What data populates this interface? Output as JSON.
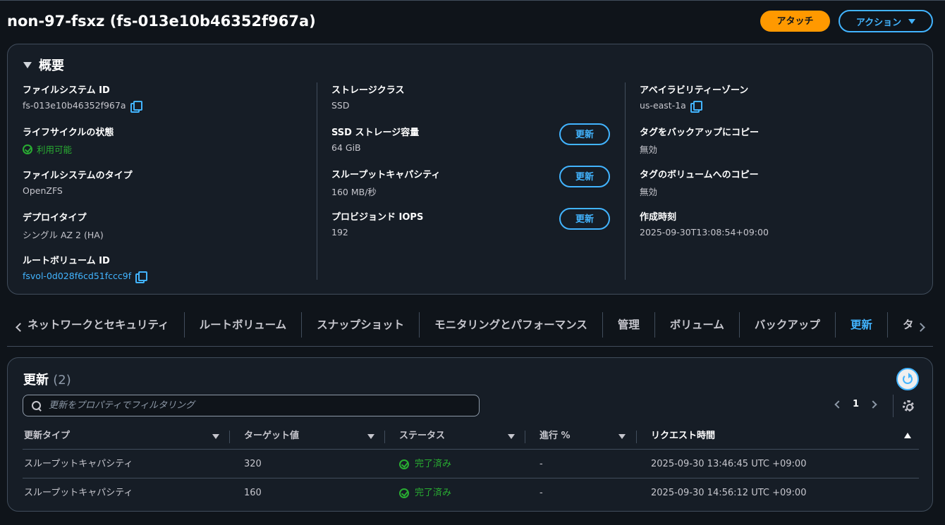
{
  "header": {
    "title": "non-97-fsxz (fs-013e10b46352f967a)",
    "attach_label": "アタッチ",
    "actions_label": "アクション"
  },
  "summary": {
    "heading": "概要",
    "col1": {
      "fs_id_label": "ファイルシステム ID",
      "fs_id_value": "fs-013e10b46352f967a",
      "lifecycle_label": "ライフサイクルの状態",
      "lifecycle_value": "利用可能",
      "fs_type_label": "ファイルシステムのタイプ",
      "fs_type_value": "OpenZFS",
      "deploy_label": "デプロイタイプ",
      "deploy_value": "シングル AZ 2 (HA)",
      "root_vol_label": "ルートボリューム ID",
      "root_vol_value": "fsvol-0d028f6cd51fccc9f"
    },
    "col2": {
      "storage_class_label": "ストレージクラス",
      "storage_class_value": "SSD",
      "ssd_capacity_label": "SSD ストレージ容量",
      "ssd_capacity_value": "64 GiB",
      "throughput_label": "スループットキャパシティ",
      "throughput_value": "160 MB/秒",
      "iops_label": "プロビジョンド IOPS",
      "iops_value": "192",
      "update_label": "更新"
    },
    "col3": {
      "az_label": "アベイラビリティーゾーン",
      "az_value": "us-east-1a",
      "copy_backup_label": "タグをバックアップにコピー",
      "copy_backup_value": "無効",
      "copy_volume_label": "タグのボリュームへのコピー",
      "copy_volume_value": "無効",
      "created_label": "作成時刻",
      "created_value": "2025-09-30T13:08:54+09:00"
    }
  },
  "tabs": [
    {
      "label": "ネットワークとセキュリティ"
    },
    {
      "label": "ルートボリューム"
    },
    {
      "label": "スナップショット"
    },
    {
      "label": "モニタリングとパフォーマンス"
    },
    {
      "label": "管理"
    },
    {
      "label": "ボリューム"
    },
    {
      "label": "バックアップ"
    },
    {
      "label": "更新",
      "active": true
    },
    {
      "label": "タグ"
    }
  ],
  "updates": {
    "title": "更新",
    "count": "(2)",
    "search_placeholder": "更新をプロパティでフィルタリング",
    "page": "1",
    "columns": [
      "更新タイプ",
      "ターゲット値",
      "ステータス",
      "進行 %",
      "リクエスト時間"
    ],
    "rows": [
      {
        "type": "スループットキャパシティ",
        "target": "320",
        "status": "完了済み",
        "progress": "-",
        "requested": "2025-09-30 13:46:45 UTC +09:00"
      },
      {
        "type": "スループットキャパシティ",
        "target": "160",
        "status": "完了済み",
        "progress": "-",
        "requested": "2025-09-30 14:56:12 UTC +09:00"
      }
    ]
  }
}
